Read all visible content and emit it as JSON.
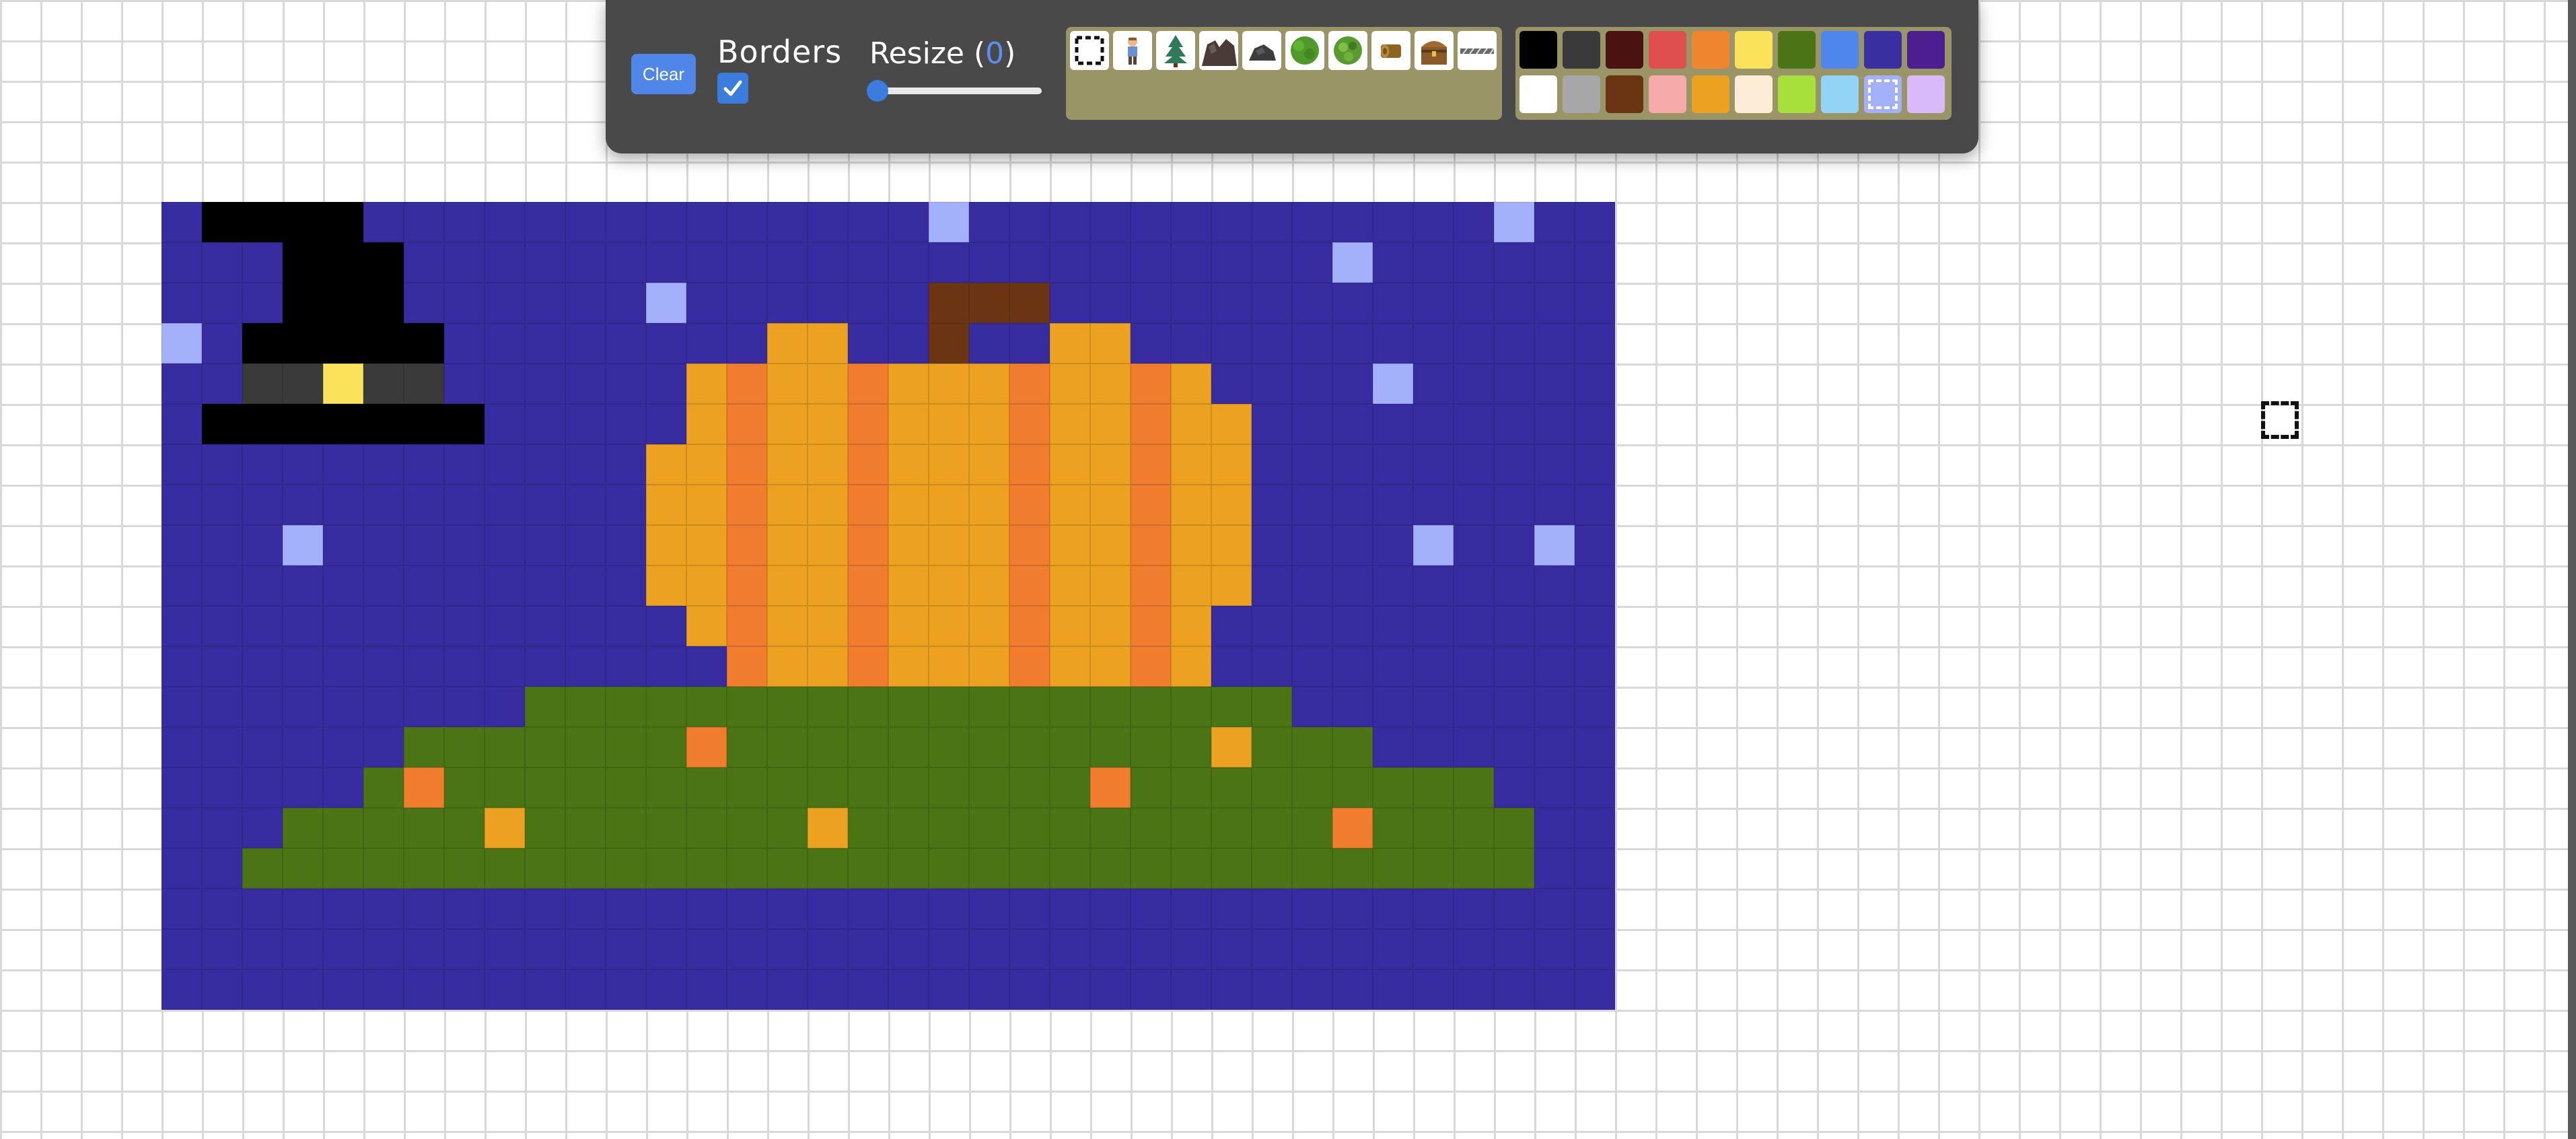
{
  "toolbar": {
    "clear_label": "Clear",
    "borders_label": "Borders",
    "borders_checked": true,
    "resize_label_prefix": "Resize (",
    "resize_value": "0",
    "resize_label_suffix": ")",
    "resize_slider_level": 0
  },
  "sprites": [
    {
      "name": "eraser",
      "selected": true
    },
    {
      "name": "person"
    },
    {
      "name": "pine-tree"
    },
    {
      "name": "rock-pile"
    },
    {
      "name": "stone"
    },
    {
      "name": "green-bush"
    },
    {
      "name": "leafy-bush"
    },
    {
      "name": "log"
    },
    {
      "name": "treasure-chest"
    },
    {
      "name": "fence"
    }
  ],
  "colors": [
    "#000000",
    "#3a3a3a",
    "#4b1212",
    "#e04f4f",
    "#f08530",
    "#fae35a",
    "#4b7514",
    "#4f86ee",
    "#3a2fa0",
    "#4b1f8f",
    "#ffffff",
    "#a7a7a7",
    "#6b3514",
    "#f6aaaa",
    "#eda120",
    "#fdecd6",
    "#a7e03a",
    "#93d3f6",
    "#a3b0fa",
    "#d8bafa"
  ],
  "selected_color": "#a3b0fa",
  "canvas": {
    "legend": {
      "B": "#372da0",
      "K": "#000000",
      "D": "#3a3a3a",
      "Y": "#fae35a",
      "L": "#a3b0fa",
      "N": "#6b3514",
      "O": "#eda120",
      "R": "#ef7d2d",
      "G": "#4b7514"
    },
    "rows": [
      "BKKKKBBBBBBBBBBBBBBLBBBBBBBBBBBBBLBB",
      "BBBKKKBBBBBBBBBBBBBBBBBBBBBBBLBBBBBB",
      "BBBKKKBBBBBBLBBBBBBNNNBBBBBBBBBBBBBB",
      "LBKKKKKBBBBBBBBOOBBNBBOOBBBBBBBBBBBB",
      "BBDDYDDBBBBBBOROOROOOROOROBBBBLBBBBB",
      "BKKKKKKKBBBBBOROOROOOROOROOBBBBBBBBB",
      "BBBBBBBBBBBBOOROOROOOROOROOBBBBBBBBB",
      "BBBBBBBBBBBBOOROOROOOROOROOBBBBBBBBB",
      "BBBLBBBBBBBBOOROOROOOROOROOBBBBLBBLB",
      "BBBBBBBBBBBBOOROOROOOROOROOBBBBBBBBB",
      "BBBBBBBBBBBBBOROOROOOROOROBBBBBBBBBB",
      "BBBBBBBBBBBBBBROOROOOROOROBBBBBBBBBB",
      "BBBBBBBBBGGGGGGGGGGGGGGGGGGGBBBBBBBB",
      "BBBBBBGGGGGGGRGGGGGGGGGGGGOGGGBBBBBB",
      "BBBBBGRGGGGGGGGGGGGGGGGRGGGGGGGGGBBB",
      "BBBGGGGGOGGGGGGGOGGGGGGGGGGGGRGGGGBB",
      "BBGGGGGGGGGGGGGGGGGGGGGGGGGGGGGGGGBB",
      "BBBBBBBBBBBBBBBBBBBBBBBBBBBBBBBBBBBB",
      "BBBBBBBBBBBBBBBBBBBBBBBBBBBBBBBBBBBB",
      "BBBBBBBBBBBBBBBBBBBBBBBBBBBBBBBBBBBB"
    ]
  }
}
